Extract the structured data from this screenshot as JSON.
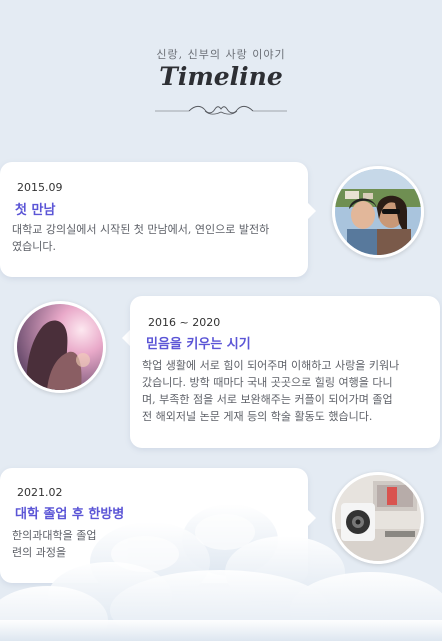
{
  "header": {
    "subtitle": "신랑, 신부의 사랑 이야기",
    "title": "Timeline"
  },
  "timeline": [
    {
      "date": "2015.09",
      "heading": "첫 만남",
      "desc_lines": [
        "대학교 강의실에서 시작된 첫 만남에서, 연인으로 발전하",
        "였습니다."
      ],
      "photo": "couple-selfie-photo"
    },
    {
      "date": "2016 ~ 2020",
      "heading": "믿음을 키우는 시기",
      "desc_lines": [
        "학업 생활에 서로 힘이 되어주며 이해하고 사랑을 키워나",
        "갔습니다. 방학 때마다 국내 곳곳으로 힐링 여행을 다니",
        "며, 부족한 점을 서로 보완해주는 커플이 되어가며 졸업",
        "전 해외저널 논문 게재 등의 학술 활동도 했습니다."
      ],
      "photo": "sunset-couple-photo"
    },
    {
      "date": "2021.02",
      "heading": "대학 졸업 후 한방병",
      "desc_lines": [
        "한의과대학을 졸업",
        "련의 과정을"
      ],
      "photo": "desk-speaker-photo"
    }
  ],
  "colors": {
    "background": "#e4ebf3",
    "accent": "#5b55d6",
    "card": "#ffffff"
  }
}
